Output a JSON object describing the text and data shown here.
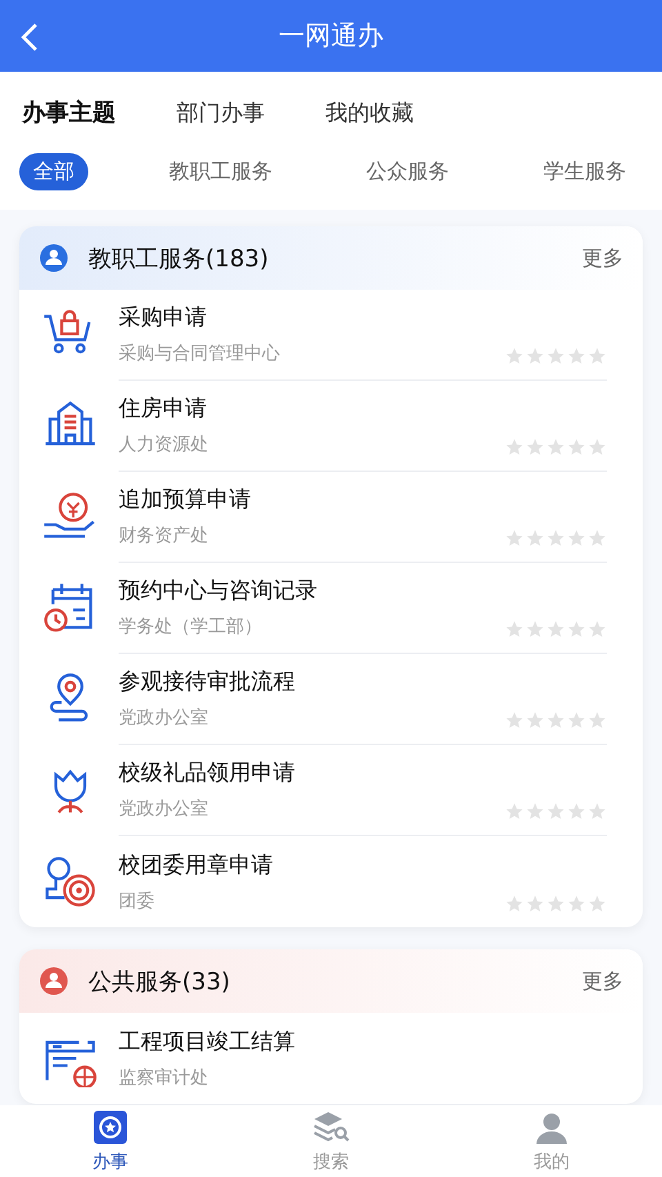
{
  "header": {
    "title": "一网通办"
  },
  "tabs": [
    {
      "label": "办事主题",
      "selected": true
    },
    {
      "label": "部门办事",
      "selected": false
    },
    {
      "label": "我的收藏",
      "selected": false
    }
  ],
  "filters": [
    {
      "label": "全部",
      "selected": true
    },
    {
      "label": "教职工服务",
      "selected": false
    },
    {
      "label": "公众服务",
      "selected": false
    },
    {
      "label": "学生服务",
      "selected": false
    }
  ],
  "sections": [
    {
      "title": "教职工服务(183)",
      "more": "更多",
      "color": "#2a6fe0",
      "items": [
        {
          "title": "采购申请",
          "subtitle": "采购与合同管理中心",
          "stars": 0
        },
        {
          "title": "住房申请",
          "subtitle": "人力资源处",
          "stars": 0
        },
        {
          "title": "追加预算申请",
          "subtitle": "财务资产处",
          "stars": 0
        },
        {
          "title": "预约中心与咨询记录",
          "subtitle": "学务处（学工部）",
          "stars": 0
        },
        {
          "title": "参观接待审批流程",
          "subtitle": "党政办公室",
          "stars": 0
        },
        {
          "title": "校级礼品领用申请",
          "subtitle": "党政办公室",
          "stars": 0
        },
        {
          "title": "校团委用章申请",
          "subtitle": "团委",
          "stars": 0
        }
      ]
    },
    {
      "title": "公共服务(33)",
      "more": "更多",
      "color": "#e0574f",
      "items": [
        {
          "title": "工程项目竣工结算",
          "subtitle": "监察审计处"
        }
      ]
    }
  ],
  "bottom_nav": [
    {
      "label": "办事",
      "selected": true
    },
    {
      "label": "搜索",
      "selected": false
    },
    {
      "label": "我的",
      "selected": false
    }
  ]
}
